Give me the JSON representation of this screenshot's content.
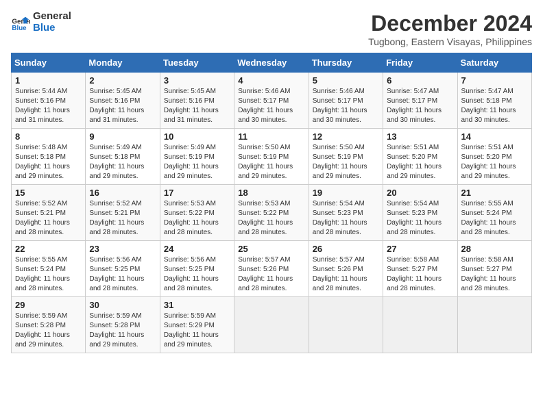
{
  "logo": {
    "line1": "General",
    "line2": "Blue"
  },
  "title": "December 2024",
  "location": "Tugbong, Eastern Visayas, Philippines",
  "headers": [
    "Sunday",
    "Monday",
    "Tuesday",
    "Wednesday",
    "Thursday",
    "Friday",
    "Saturday"
  ],
  "weeks": [
    [
      {
        "day": 1,
        "sunrise": "5:44 AM",
        "sunset": "5:16 PM",
        "daylight": "11 hours and 31 minutes."
      },
      {
        "day": 2,
        "sunrise": "5:45 AM",
        "sunset": "5:16 PM",
        "daylight": "11 hours and 31 minutes."
      },
      {
        "day": 3,
        "sunrise": "5:45 AM",
        "sunset": "5:16 PM",
        "daylight": "11 hours and 31 minutes."
      },
      {
        "day": 4,
        "sunrise": "5:46 AM",
        "sunset": "5:17 PM",
        "daylight": "11 hours and 30 minutes."
      },
      {
        "day": 5,
        "sunrise": "5:46 AM",
        "sunset": "5:17 PM",
        "daylight": "11 hours and 30 minutes."
      },
      {
        "day": 6,
        "sunrise": "5:47 AM",
        "sunset": "5:17 PM",
        "daylight": "11 hours and 30 minutes."
      },
      {
        "day": 7,
        "sunrise": "5:47 AM",
        "sunset": "5:18 PM",
        "daylight": "11 hours and 30 minutes."
      }
    ],
    [
      {
        "day": 8,
        "sunrise": "5:48 AM",
        "sunset": "5:18 PM",
        "daylight": "11 hours and 29 minutes."
      },
      {
        "day": 9,
        "sunrise": "5:49 AM",
        "sunset": "5:18 PM",
        "daylight": "11 hours and 29 minutes."
      },
      {
        "day": 10,
        "sunrise": "5:49 AM",
        "sunset": "5:19 PM",
        "daylight": "11 hours and 29 minutes."
      },
      {
        "day": 11,
        "sunrise": "5:50 AM",
        "sunset": "5:19 PM",
        "daylight": "11 hours and 29 minutes."
      },
      {
        "day": 12,
        "sunrise": "5:50 AM",
        "sunset": "5:19 PM",
        "daylight": "11 hours and 29 minutes."
      },
      {
        "day": 13,
        "sunrise": "5:51 AM",
        "sunset": "5:20 PM",
        "daylight": "11 hours and 29 minutes."
      },
      {
        "day": 14,
        "sunrise": "5:51 AM",
        "sunset": "5:20 PM",
        "daylight": "11 hours and 29 minutes."
      }
    ],
    [
      {
        "day": 15,
        "sunrise": "5:52 AM",
        "sunset": "5:21 PM",
        "daylight": "11 hours and 28 minutes."
      },
      {
        "day": 16,
        "sunrise": "5:52 AM",
        "sunset": "5:21 PM",
        "daylight": "11 hours and 28 minutes."
      },
      {
        "day": 17,
        "sunrise": "5:53 AM",
        "sunset": "5:22 PM",
        "daylight": "11 hours and 28 minutes."
      },
      {
        "day": 18,
        "sunrise": "5:53 AM",
        "sunset": "5:22 PM",
        "daylight": "11 hours and 28 minutes."
      },
      {
        "day": 19,
        "sunrise": "5:54 AM",
        "sunset": "5:23 PM",
        "daylight": "11 hours and 28 minutes."
      },
      {
        "day": 20,
        "sunrise": "5:54 AM",
        "sunset": "5:23 PM",
        "daylight": "11 hours and 28 minutes."
      },
      {
        "day": 21,
        "sunrise": "5:55 AM",
        "sunset": "5:24 PM",
        "daylight": "11 hours and 28 minutes."
      }
    ],
    [
      {
        "day": 22,
        "sunrise": "5:55 AM",
        "sunset": "5:24 PM",
        "daylight": "11 hours and 28 minutes."
      },
      {
        "day": 23,
        "sunrise": "5:56 AM",
        "sunset": "5:25 PM",
        "daylight": "11 hours and 28 minutes."
      },
      {
        "day": 24,
        "sunrise": "5:56 AM",
        "sunset": "5:25 PM",
        "daylight": "11 hours and 28 minutes."
      },
      {
        "day": 25,
        "sunrise": "5:57 AM",
        "sunset": "5:26 PM",
        "daylight": "11 hours and 28 minutes."
      },
      {
        "day": 26,
        "sunrise": "5:57 AM",
        "sunset": "5:26 PM",
        "daylight": "11 hours and 28 minutes."
      },
      {
        "day": 27,
        "sunrise": "5:58 AM",
        "sunset": "5:27 PM",
        "daylight": "11 hours and 28 minutes."
      },
      {
        "day": 28,
        "sunrise": "5:58 AM",
        "sunset": "5:27 PM",
        "daylight": "11 hours and 28 minutes."
      }
    ],
    [
      {
        "day": 29,
        "sunrise": "5:59 AM",
        "sunset": "5:28 PM",
        "daylight": "11 hours and 29 minutes."
      },
      {
        "day": 30,
        "sunrise": "5:59 AM",
        "sunset": "5:28 PM",
        "daylight": "11 hours and 29 minutes."
      },
      {
        "day": 31,
        "sunrise": "5:59 AM",
        "sunset": "5:29 PM",
        "daylight": "11 hours and 29 minutes."
      },
      null,
      null,
      null,
      null
    ]
  ]
}
